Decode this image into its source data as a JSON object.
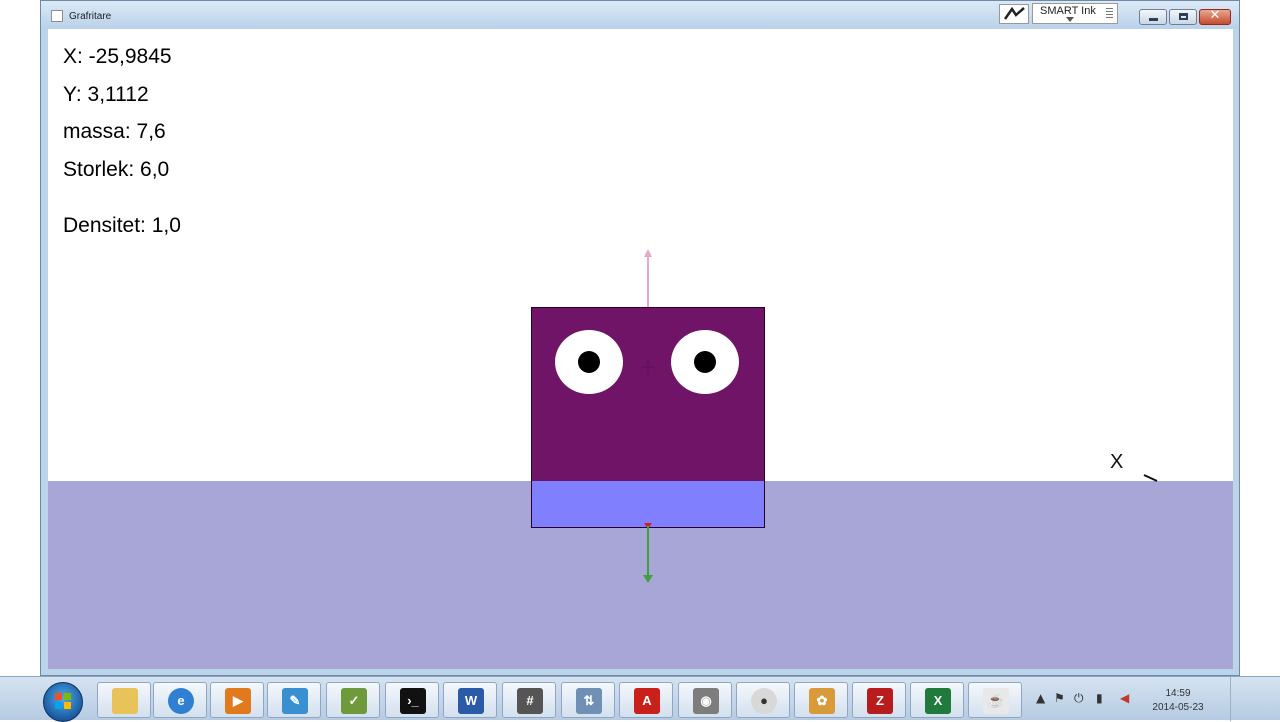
{
  "window": {
    "title": "Grafritare",
    "smart_ink_label": "SMART Ink"
  },
  "readout": {
    "x": "X: -25,9845",
    "y": "Y: 3,1112",
    "massa": "massa: 7,6",
    "storlek": "Storlek: 6,0",
    "densitet": "Densitet: 1,0"
  },
  "scene": {
    "marker_label": "X",
    "colors": {
      "block": "#701468",
      "submerged_part": "#8080ff",
      "water": "#a8a6d6",
      "buoyancy_arrow": "#e8a8c8",
      "gravity_arrow": "#40a040"
    }
  },
  "taskbar": {
    "apps": [
      {
        "icon": "folder-icon"
      },
      {
        "icon": "internet-explorer-icon"
      },
      {
        "icon": "media-player-icon"
      },
      {
        "icon": "notes-icon"
      },
      {
        "icon": "spreadsheet-edit-icon"
      },
      {
        "icon": "command-prompt-icon"
      },
      {
        "icon": "word-icon"
      },
      {
        "icon": "calculator-icon"
      },
      {
        "icon": "network-icon"
      },
      {
        "icon": "pdf-icon"
      },
      {
        "icon": "camera-icon"
      },
      {
        "icon": "cd-icon"
      },
      {
        "icon": "paint-icon"
      },
      {
        "icon": "filezilla-icon"
      },
      {
        "icon": "excel-icon"
      },
      {
        "icon": "java-icon"
      }
    ],
    "clock_time": "14:59",
    "clock_date": "2014-05-23"
  }
}
